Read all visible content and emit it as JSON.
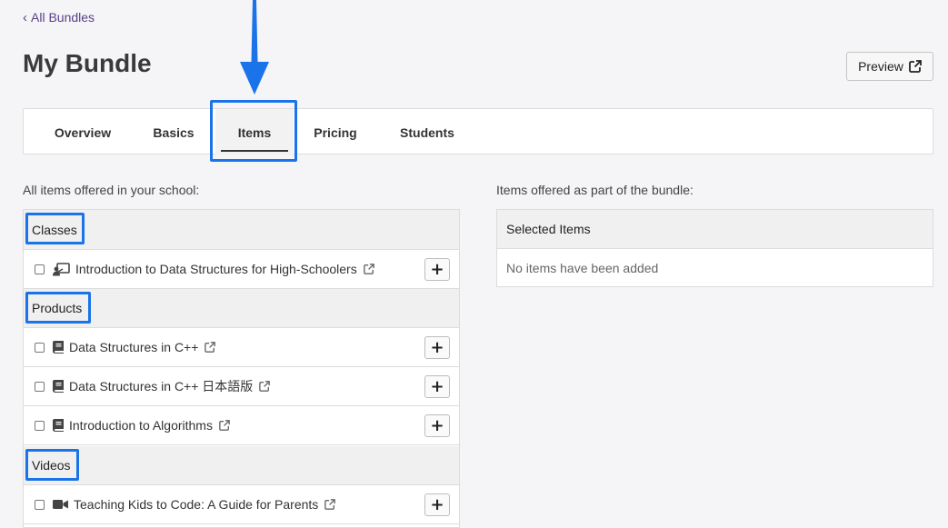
{
  "nav": {
    "back_label": "All Bundles"
  },
  "page": {
    "title": "My Bundle"
  },
  "toolbar": {
    "preview_label": "Preview"
  },
  "tabs": [
    {
      "label": "Overview"
    },
    {
      "label": "Basics"
    },
    {
      "label": "Items",
      "active": true
    },
    {
      "label": "Pricing"
    },
    {
      "label": "Students"
    }
  ],
  "school_items": {
    "label": "All items offered in your school:",
    "categories": [
      {
        "name": "Classes",
        "icon": "live-class-icon",
        "items": [
          {
            "name": "Introduction to Data Structures for High-Schoolers",
            "checked": false
          }
        ]
      },
      {
        "name": "Products",
        "icon": "book-icon",
        "items": [
          {
            "name": "Data Structures in C++",
            "checked": false
          },
          {
            "name": "Data Structures in C++ 日本語版",
            "checked": false
          },
          {
            "name": "Introduction to Algorithms",
            "checked": false
          }
        ]
      },
      {
        "name": "Videos",
        "icon": "video-camera-icon",
        "items": [
          {
            "name": "Teaching Kids to Code: A Guide for Parents",
            "checked": false
          }
        ]
      }
    ],
    "add_label": "+"
  },
  "bundle_items": {
    "label": "Items offered as part of the bundle:",
    "header": "Selected Items",
    "empty_text": "No items have been added"
  },
  "colors": {
    "highlight": "#1a73e8",
    "link": "#5b3f86"
  }
}
